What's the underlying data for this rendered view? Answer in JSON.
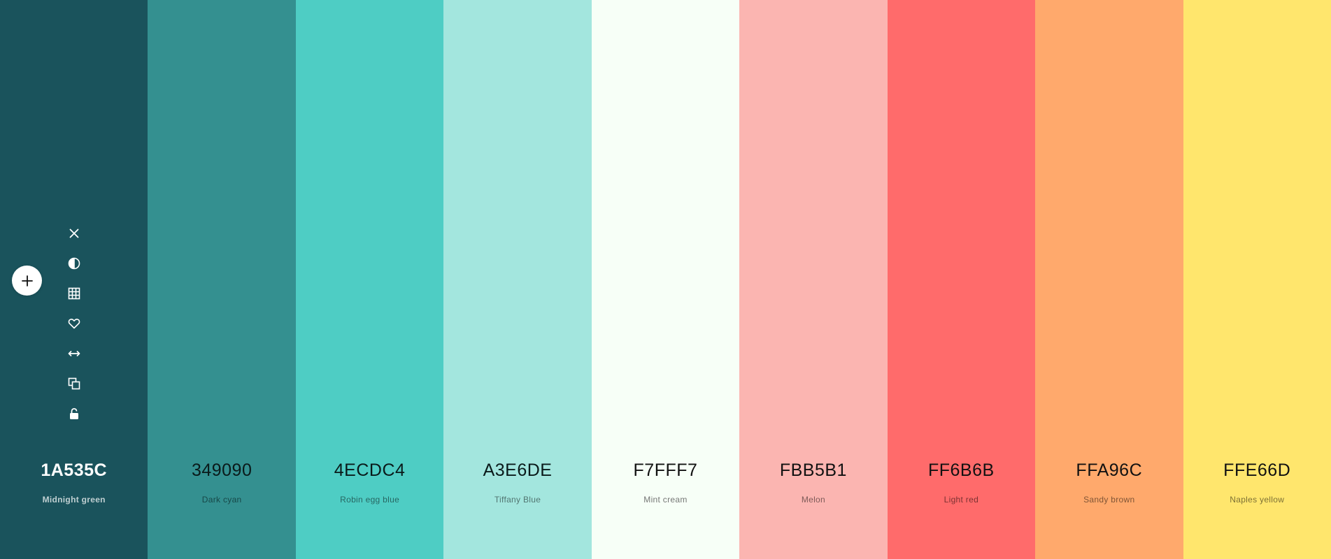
{
  "swatches": [
    {
      "hex": "1A535C",
      "name": "Midnight green",
      "bg": "#1A535C",
      "fg": "#FFFFFF",
      "sub": "#C8D6D8"
    },
    {
      "hex": "349090",
      "name": "Dark cyan",
      "bg": "#349090",
      "fg": "#0A1A1A",
      "sub": "#0F3535"
    },
    {
      "hex": "4ECDC4",
      "name": "Robin egg blue",
      "bg": "#4ECDC4",
      "fg": "#0A1A1A",
      "sub": "#1E4D4A"
    },
    {
      "hex": "A3E6DE",
      "name": "Tiffany Blue",
      "bg": "#A3E6DE",
      "fg": "#0A1A1A",
      "sub": "#3E5A56"
    },
    {
      "hex": "F7FFF7",
      "name": "Mint cream",
      "bg": "#F7FFF7",
      "fg": "#111111",
      "sub": "#555555"
    },
    {
      "hex": "FBB5B1",
      "name": "Melon",
      "bg": "#FBB5B1",
      "fg": "#111111",
      "sub": "#5E4442"
    },
    {
      "hex": "FF6B6B",
      "name": "Light red",
      "bg": "#FF6B6B",
      "fg": "#111111",
      "sub": "#5A2424"
    },
    {
      "hex": "FFA96C",
      "name": "Sandy brown",
      "bg": "#FFA96C",
      "fg": "#111111",
      "sub": "#5E3F28"
    },
    {
      "hex": "FFE66D",
      "name": "Naples yellow",
      "bg": "#FFE66D",
      "fg": "#111111",
      "sub": "#5C5328"
    }
  ],
  "toolbar": {
    "icons": [
      "close-icon",
      "contrast-icon",
      "grid-icon",
      "heart-icon",
      "drag-horizontal-icon",
      "copy-icon",
      "unlock-icon"
    ]
  },
  "add_button": {
    "icon": "plus-icon"
  }
}
